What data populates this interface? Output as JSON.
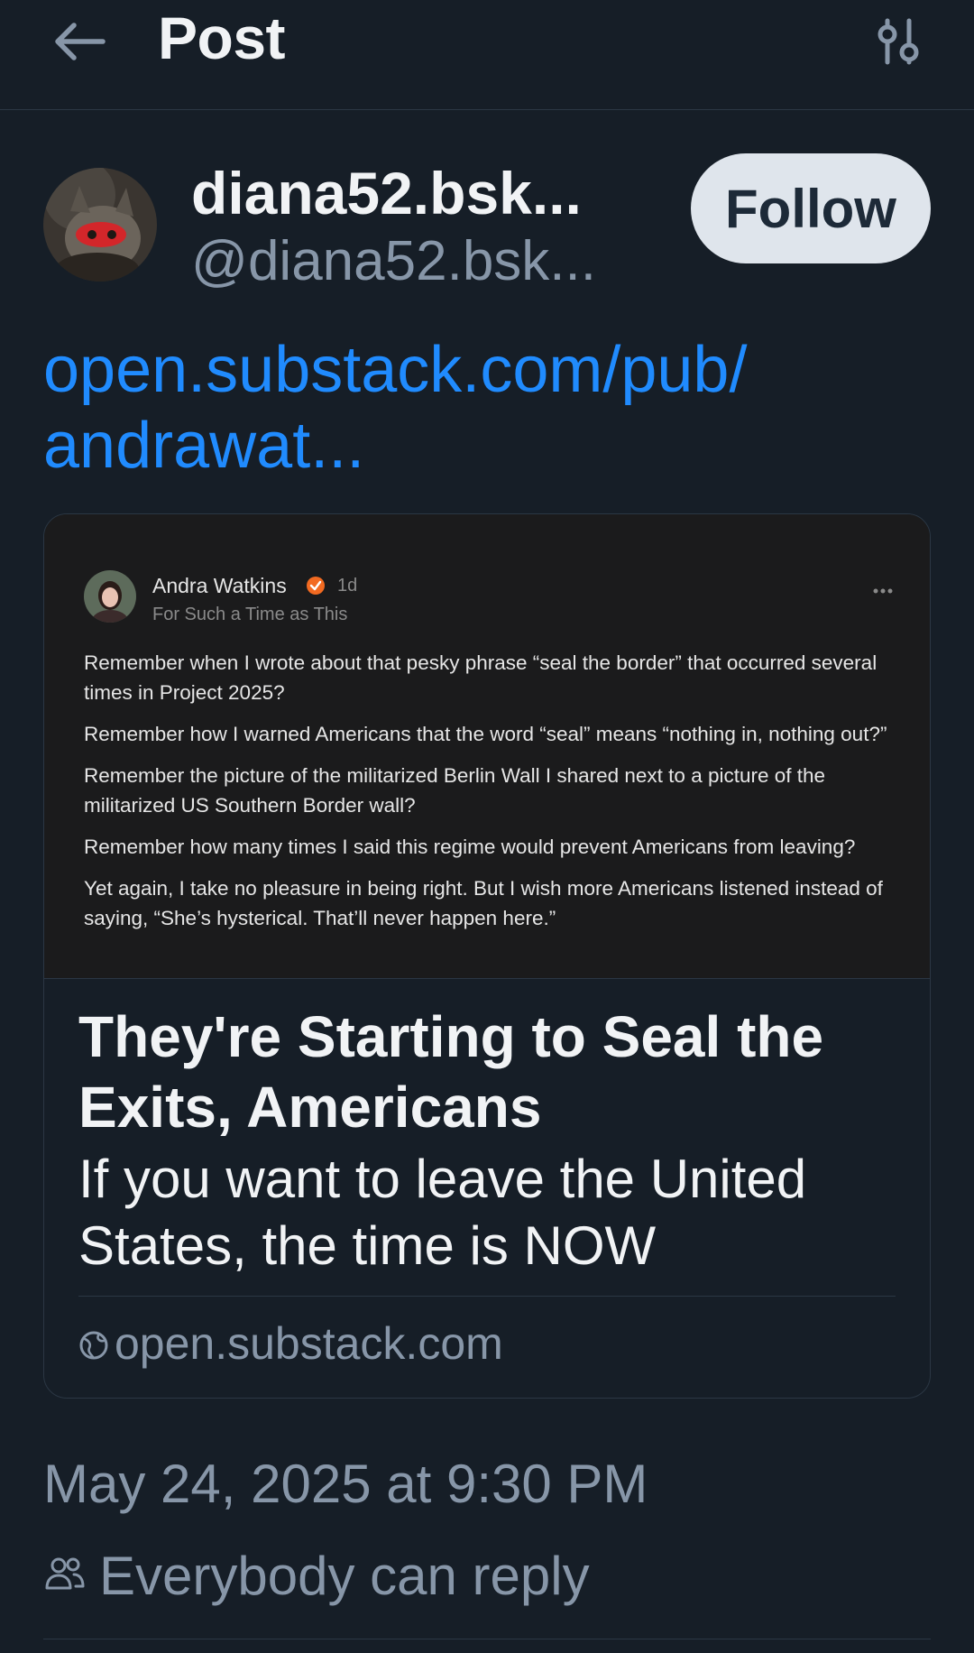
{
  "header": {
    "title": "Post",
    "back_icon": "arrow-left-icon",
    "settings_icon": "sliders-icon"
  },
  "author": {
    "display_name": "diana52.bsk...",
    "handle": "@diana52.bsk...",
    "follow_label": "Follow"
  },
  "post": {
    "link_text": "open.substack.com/pub/\nandrawat..."
  },
  "card": {
    "preview": {
      "author": "Andra Watkins",
      "time": "1d",
      "publication": "For Such a Time as This",
      "paragraphs": [
        "Remember when I wrote about that pesky phrase “seal the border” that occurred several times in Project 2025?",
        "Remember how I warned Americans that the word “seal” means “nothing in, nothing out?”",
        "Remember the picture of the militarized Berlin Wall I shared next to a picture of the militarized US Southern Border wall?",
        "Remember how many times I said this regime would prevent Americans from leaving?",
        "Yet again, I take no pleasure in being right. But I wish more Americans listened instead of saying, “She’s hysterical. That’ll never happen here.”"
      ]
    },
    "title": "They're Starting to Seal the Exits, Americans",
    "description": "If you want to leave the United States, the time is NOW",
    "domain": "open.substack.com",
    "domain_icon": "globe-icon"
  },
  "meta": {
    "timestamp": "May 24, 2025 at 9:30 PM",
    "reply_setting": "Everybody can reply",
    "reply_icon": "people-icon"
  },
  "colors": {
    "background": "#161e27",
    "link": "#208bfe",
    "muted": "#8796a8",
    "follow_bg": "#dfe5ec",
    "accent_badge": "#f26a21"
  }
}
